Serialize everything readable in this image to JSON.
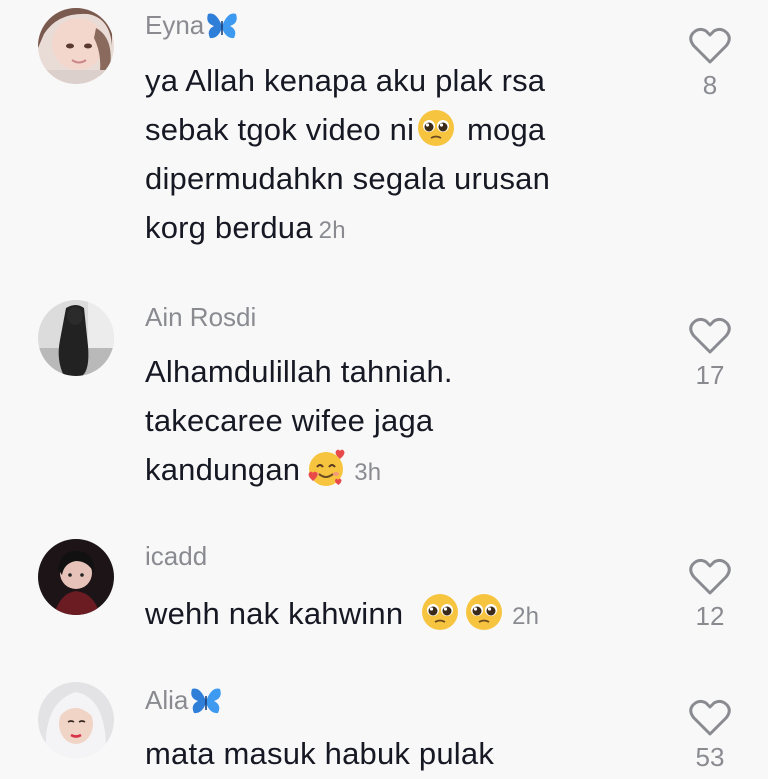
{
  "comments": [
    {
      "username": "Eyna",
      "username_emoji": "butterfly-emoji",
      "lines": [
        "ya Allah kenapa aku plak rsa",
        "sebak tgok video ni",
        "dipermudahkn segala urusan",
        "korg berdua"
      ],
      "line2_suffix": "moga",
      "inline_emoji": "pleading-face-emoji",
      "time": "2h",
      "likes": "8"
    },
    {
      "username": "Ain Rosdi",
      "lines": [
        "Alhamdulillah tahniah.",
        "takecaree wifee jaga",
        "kandungan"
      ],
      "inline_emoji": "smiling-face-with-hearts-emoji",
      "time": "3h",
      "likes": "17"
    },
    {
      "username": "icadd",
      "lines": [
        "wehh nak kahwinn"
      ],
      "inline_emoji": "pleading-face-emoji",
      "time": "2h",
      "likes": "12"
    },
    {
      "username": "Alia",
      "username_emoji": "butterfly-emoji",
      "lines": [
        "mata masuk habuk pulak"
      ],
      "likes": "53"
    }
  ],
  "icons": {
    "like": "heart-outline-icon"
  },
  "colors": {
    "background": "#f8f8f8",
    "text": "#161823",
    "secondary": "#8a8b91",
    "butterfly": "#3a8ee6"
  }
}
